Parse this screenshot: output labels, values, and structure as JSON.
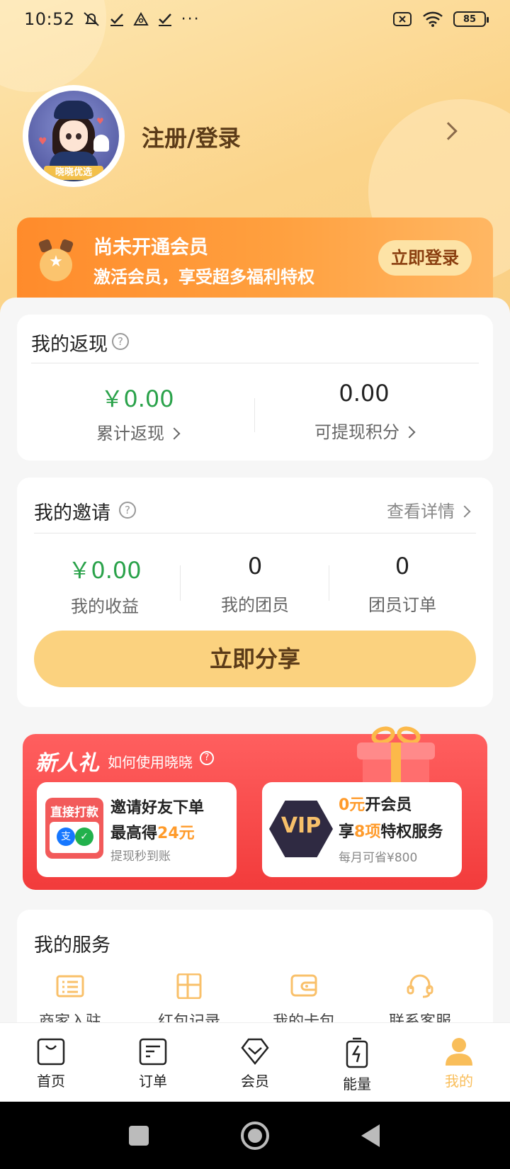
{
  "status": {
    "time": "10:52",
    "battery": "85"
  },
  "profile": {
    "avatar_tag": "晓晓优选",
    "login_text": "注册/登录"
  },
  "member": {
    "title": "尚未开通会员",
    "subtitle": "激活会员，享受超多福利特权",
    "login_button": "立即登录"
  },
  "cashback": {
    "title": "我的返现",
    "total_value": "￥0.00",
    "total_label": "累计返现",
    "points_value": "0.00",
    "points_label": "可提现积分"
  },
  "invite": {
    "title": "我的邀请",
    "details_link": "查看详情",
    "stats": [
      {
        "value": "￥0.00",
        "label": "我的收益"
      },
      {
        "value": "0",
        "label": "我的团员"
      },
      {
        "value": "0",
        "label": "团员订单"
      }
    ],
    "share_button": "立即分享"
  },
  "gift": {
    "title": "新人礼",
    "subtitle": "如何使用晓晓",
    "left": {
      "badge": "直接打款",
      "line1": "邀请好友下单",
      "line2_prefix": "最高得",
      "line2_highlight": "24元",
      "line3": "提现秒到账"
    },
    "right": {
      "badge": "VIP",
      "line1_highlight": "0元",
      "line1_suffix": "开会员",
      "line2_prefix": "享",
      "line2_highlight": "8项",
      "line2_suffix": "特权服务",
      "line3": "每月可省¥800"
    }
  },
  "services": {
    "title": "我的服务",
    "items": [
      {
        "label": "商家入驻",
        "icon": "store-list-icon"
      },
      {
        "label": "红包记录",
        "icon": "grid-record-icon"
      },
      {
        "label": "我的卡包",
        "icon": "wallet-icon"
      },
      {
        "label": "联系客服",
        "icon": "headset-icon"
      }
    ]
  },
  "tabs": [
    {
      "label": "首页",
      "icon": "shopping-bag-icon"
    },
    {
      "label": "订单",
      "icon": "order-list-icon"
    },
    {
      "label": "会员",
      "icon": "diamond-icon"
    },
    {
      "label": "能量",
      "icon": "battery-bolt-icon"
    },
    {
      "label": "我的",
      "icon": "user-icon"
    }
  ],
  "colors": {
    "accent": "#fbd27f",
    "green": "#2aa24a",
    "orange": "#ff8b2b",
    "red": "#f23b3b",
    "active_tab": "#f9be5a"
  }
}
